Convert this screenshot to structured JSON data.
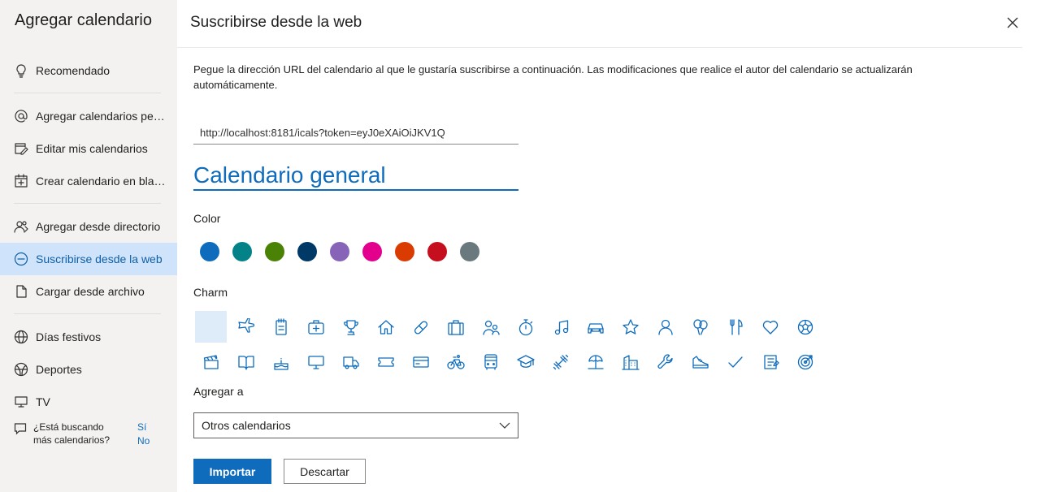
{
  "sidebar": {
    "title": "Agregar calendario",
    "items": [
      {
        "label": "Recomendado",
        "icon": "lightbulb-icon"
      },
      {
        "label": "Agregar calendarios per…",
        "icon": "at-icon"
      },
      {
        "label": "Editar mis calendarios",
        "icon": "edit-calendar-icon"
      },
      {
        "label": "Crear calendario en blan…",
        "icon": "add-calendar-icon"
      },
      {
        "label": "Agregar desde directorio",
        "icon": "people-icon"
      },
      {
        "label": "Suscribirse desde la web",
        "icon": "link-icon",
        "active": true
      },
      {
        "label": "Cargar desde archivo",
        "icon": "document-icon"
      },
      {
        "label": "Días festivos",
        "icon": "globe-icon"
      },
      {
        "label": "Deportes",
        "icon": "sports-icon"
      },
      {
        "label": "TV",
        "icon": "tv-icon"
      }
    ],
    "help": {
      "text": "¿Está buscando más calendarios?",
      "yes": "Sí",
      "no": "No"
    }
  },
  "main": {
    "title": "Suscribirse desde la web",
    "description": "Pegue la dirección URL del calendario al que le gustaría suscribirse a continuación. Las modificaciones que realice el autor del calendario se actualizarán automáticamente.",
    "url_value": "http://localhost:8181/icals?token=eyJ0eXAiOiJKV1Q",
    "calendar_name": "Calendario general",
    "color_label": "Color",
    "colors": [
      "#0f6cbd",
      "#038387",
      "#498205",
      "#003966",
      "#8764b8",
      "#e3008c",
      "#da3b01",
      "#c50f1f",
      "#69797e"
    ],
    "charm_label": "Charm",
    "add_to_label": "Agregar a",
    "add_to_value": "Otros calendarios",
    "import_label": "Importar",
    "discard_label": "Descartar"
  },
  "charms": [
    "blank-charm",
    "airplane-icon",
    "notepad-icon",
    "medical-kit-icon",
    "trophy-icon",
    "home-icon",
    "pill-icon",
    "briefcase-icon",
    "people-icon",
    "stopwatch-icon",
    "music-note-icon",
    "car-icon",
    "star-icon",
    "person-icon",
    "balloons-icon",
    "fork-knife-icon",
    "heart-icon",
    "soccer-ball-icon",
    "clapperboard-icon",
    "book-icon",
    "cake-icon",
    "desktop-icon",
    "truck-icon",
    "ticket-icon",
    "credit-card-icon",
    "bicycle-icon",
    "bus-icon",
    "graduation-cap-icon",
    "dumbbell-icon",
    "beach-icon",
    "building-icon",
    "wrench-icon",
    "sneaker-icon",
    "checkmark-icon",
    "checklist-icon",
    "target-icon"
  ]
}
